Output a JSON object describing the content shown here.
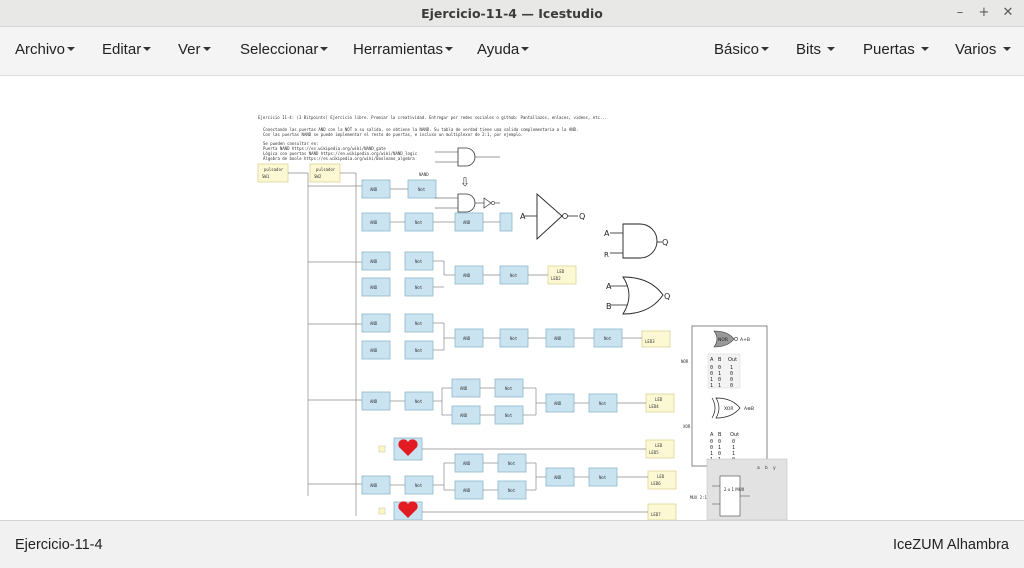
{
  "window": {
    "title": "Ejercicio-11-4 — Icestudio"
  },
  "window_controls": [
    "–",
    "+",
    "✕"
  ],
  "menu": {
    "left": [
      "Archivo",
      "Editar",
      "Ver",
      "Seleccionar",
      "Herramientas",
      "Ayuda"
    ],
    "right": [
      "Básico",
      "Bits",
      "Puertas",
      "Varios"
    ]
  },
  "canvas": {
    "header_lines": [
      "Ejercicio 11-4: (3 Bitpoints) Ejercicio libre. Premiar la creatividad. Entregar por redes sociales o github: Pantallazos, enlaces, videos, etc...",
      "Conectando las puertas AND con la NOT a su salida, se obtiene la NAND. Su tabla de verdad tiene una salida complementaria a la AND.",
      "Con las puertas NAND se puede implementar el resto de puertas, e incluso un multiplexor de 2:1, por ejemplo.",
      "Se pueden consultar en:",
      "Puerta NAND https://es.wikipedia.org/wiki/NAND_gate",
      "Lógica con puertas NAND https://en.wikipedia.org/wiki/NAND_logic",
      "Álgebra de boole https://es.wikipedia.org/wiki/Booleano_algebra"
    ],
    "pulsador_1": "pulsador",
    "pulsador_1_value": "SW1",
    "pulsador_2": "pulsador",
    "pulsador_2_value": "SW2",
    "nand_label": "NAND",
    "block_and": "AND",
    "block_not": "Not",
    "led_title": "LED",
    "leds": [
      "LED1",
      "LED2",
      "LED3",
      "LED4",
      "LED5",
      "LED6",
      "LED7"
    ],
    "nor_label": "NOR",
    "xor_label": "XOR",
    "nor_gate_text": "NOR",
    "nor_output": "A+B",
    "xor_gate_text": "XOR",
    "xor_output": "A⊕B",
    "truth_header": [
      "A",
      "B",
      "Out"
    ],
    "nor_table": [
      [
        "0",
        "0",
        "1"
      ],
      [
        "0",
        "1",
        "0"
      ],
      [
        "1",
        "0",
        "0"
      ],
      [
        "1",
        "1",
        "0"
      ]
    ],
    "xor_table": [
      [
        "0",
        "0",
        "0"
      ],
      [
        "0",
        "1",
        "1"
      ],
      [
        "1",
        "0",
        "1"
      ],
      [
        "1",
        "1",
        "0"
      ]
    ],
    "mux_label": "MUX 2:1",
    "mux_block": "2 x 1 MUX",
    "mux_header": [
      "a",
      "b",
      "y"
    ],
    "gate_a": "A",
    "gate_b": "B",
    "gate_q": "Q",
    "gate_r": "R"
  },
  "status": {
    "file": "Ejercicio-11-4",
    "board": "IceZUM Alhambra"
  }
}
